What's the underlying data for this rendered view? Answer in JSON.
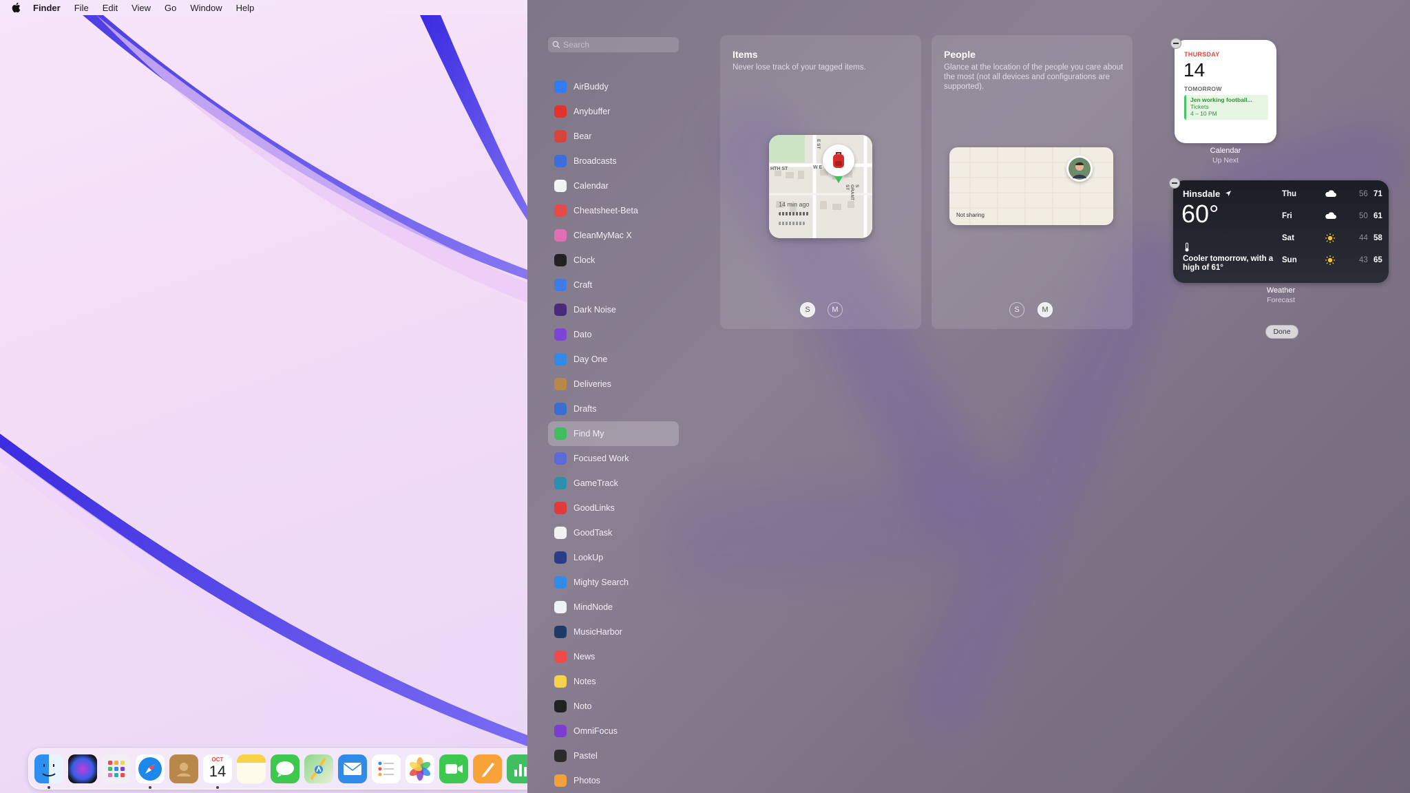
{
  "menubar": {
    "app": "Finder",
    "items": [
      "File",
      "Edit",
      "View",
      "Go",
      "Window",
      "Help"
    ]
  },
  "gallery": {
    "search_placeholder": "Search",
    "apps": [
      {
        "label": "AirBuddy",
        "color": "#2f7cf6"
      },
      {
        "label": "Anybuffer",
        "color": "#e5322d"
      },
      {
        "label": "Bear",
        "color": "#d8443a"
      },
      {
        "label": "Broadcasts",
        "color": "#3b6fe0"
      },
      {
        "label": "Calendar",
        "color": "#f4f4f4"
      },
      {
        "label": "Cheatsheet-Beta",
        "color": "#e74a4a"
      },
      {
        "label": "CleanMyMac X",
        "color": "#e16fb5"
      },
      {
        "label": "Clock",
        "color": "#222222"
      },
      {
        "label": "Craft",
        "color": "#3e7be8"
      },
      {
        "label": "Dark Noise",
        "color": "#4a2a7a"
      },
      {
        "label": "Dato",
        "color": "#7d45d6"
      },
      {
        "label": "Day One",
        "color": "#2f8ae8"
      },
      {
        "label": "Deliveries",
        "color": "#b8884a"
      },
      {
        "label": "Drafts",
        "color": "#3a6ed0"
      },
      {
        "label": "Find My",
        "color": "#3fbf5f"
      },
      {
        "label": "Focused Work",
        "color": "#5a6ad8"
      },
      {
        "label": "GameTrack",
        "color": "#2b8fb0"
      },
      {
        "label": "GoodLinks",
        "color": "#e03a3a"
      },
      {
        "label": "GoodTask",
        "color": "#f2f2f2"
      },
      {
        "label": "LookUp",
        "color": "#2a3c8a"
      },
      {
        "label": "Mighty Search",
        "color": "#2f8ae8"
      },
      {
        "label": "MindNode",
        "color": "#eef3fa"
      },
      {
        "label": "MusicHarbor",
        "color": "#1e3a66"
      },
      {
        "label": "News",
        "color": "#f24a4a"
      },
      {
        "label": "Notes",
        "color": "#f7d34a"
      },
      {
        "label": "Noto",
        "color": "#222222"
      },
      {
        "label": "OmniFocus",
        "color": "#7a3fd0"
      },
      {
        "label": "Pastel",
        "color": "#2a2a2a"
      },
      {
        "label": "Photos",
        "color": "#f2a03a"
      }
    ],
    "selected_app": "Find My",
    "items_widget": {
      "title": "Items",
      "desc": "Never lose track of your tagged items.",
      "map_street_1": "HTH ST",
      "map_street_2": "W E",
      "map_street_3": "S GRANT ST",
      "map_street_4": "E ST",
      "time_ago": "14 min ago",
      "sizes": [
        "S",
        "M"
      ]
    },
    "people_widget": {
      "title": "People",
      "desc": "Glance at the location of the people you care about the most (not all devices and configurations are supported).",
      "status": "Not sharing",
      "sizes": [
        "S",
        "M"
      ]
    }
  },
  "calendar_widget": {
    "day": "THURSDAY",
    "date": "14",
    "tomorrow": "TOMORROW",
    "event_title": "Jen working football...",
    "event_note": "Tickets",
    "event_time": "4 – 10 PM",
    "label": "Calendar",
    "sub": "Up Next"
  },
  "weather_widget": {
    "city": "Hinsdale",
    "temp": "60°",
    "desc": "Cooler tomorrow, with a high of 61°",
    "forecast": [
      {
        "day": "Thu",
        "icon": "cloud",
        "lo": "56",
        "hi": "71"
      },
      {
        "day": "Fri",
        "icon": "cloud",
        "lo": "50",
        "hi": "61"
      },
      {
        "day": "Sat",
        "icon": "sun",
        "lo": "44",
        "hi": "58"
      },
      {
        "day": "Sun",
        "icon": "sun",
        "lo": "43",
        "hi": "65"
      }
    ],
    "label": "Weather",
    "sub": "Forecast"
  },
  "done_label": "Done",
  "dock": {
    "calendar_month": "OCT",
    "calendar_day": "14"
  }
}
